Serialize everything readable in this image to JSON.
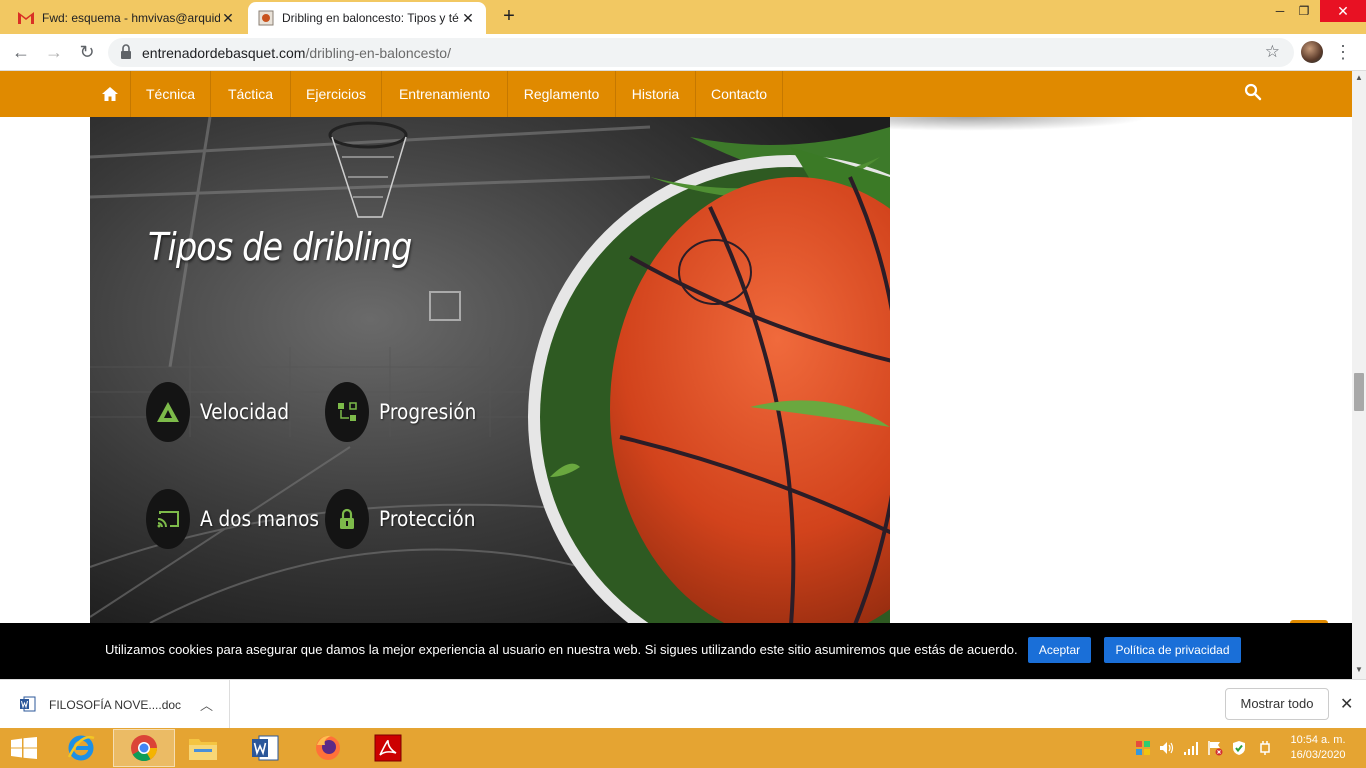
{
  "browser": {
    "tabs": [
      {
        "title": "Fwd: esquema - hmvivas@arquid",
        "icon": "gmail-icon",
        "active": false
      },
      {
        "title": "Dribling en baloncesto: Tipos y té",
        "icon": "site-favicon",
        "active": true
      }
    ],
    "new_tab": "+",
    "url_domain": "entrenadordebasquet.com",
    "url_path": "/dribling-en-baloncesto/"
  },
  "site": {
    "nav": [
      "Técnica",
      "Táctica",
      "Ejercicios",
      "Entrenamiento",
      "Reglamento",
      "Historia",
      "Contacto"
    ],
    "brand_color": "#e08a00"
  },
  "hero": {
    "heading": "Tipos de dribling",
    "features": [
      {
        "label": "Velocidad",
        "icon": "triangle-icon"
      },
      {
        "label": "Progresión",
        "icon": "flow-icon"
      },
      {
        "label": "A dos manos",
        "icon": "cast-icon"
      },
      {
        "label": "Protección",
        "icon": "lock-icon"
      }
    ],
    "accent_color": "#7dbb4a"
  },
  "cookie": {
    "message": "Utilizamos cookies para asegurar que damos la mejor experiencia al usuario en nuestra web. Si sigues utilizando este sitio asumiremos que estás de acuerdo.",
    "accept": "Aceptar",
    "privacy": "Política de privacidad"
  },
  "downloads": {
    "file": "FILOSOFÍA NOVE....doc",
    "show_all": "Mostrar todo"
  },
  "taskbar": {
    "time": "10:54 a. m.",
    "date": "16/03/2020"
  }
}
